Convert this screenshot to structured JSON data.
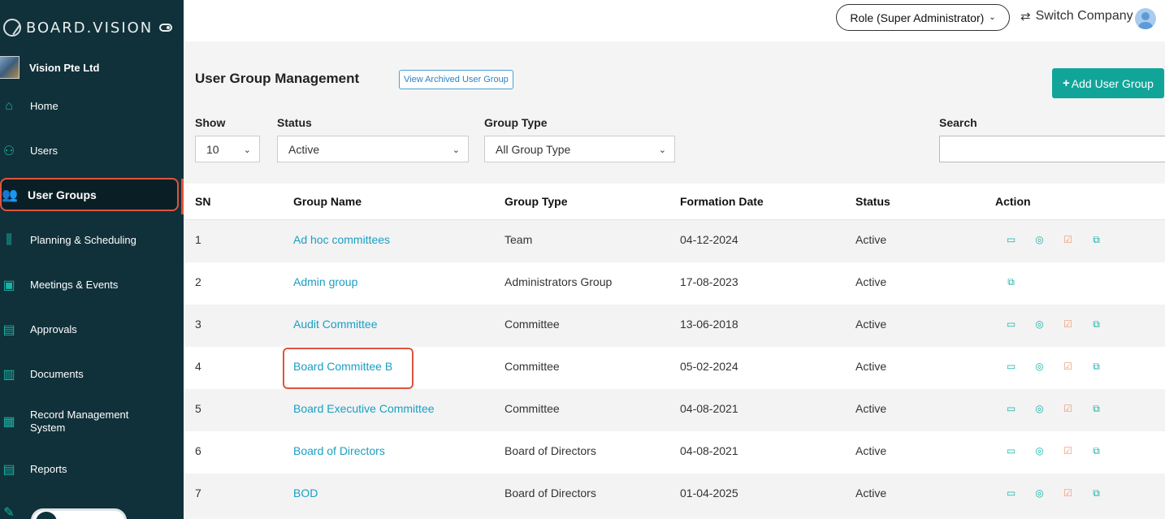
{
  "brand": {
    "name": "BOARD.VISION"
  },
  "company": {
    "name": "Vision Pte Ltd"
  },
  "sidebar": {
    "items": [
      {
        "label": "Home",
        "icon": "home-icon"
      },
      {
        "label": "Users",
        "icon": "user-icon"
      },
      {
        "label": "User Groups",
        "icon": "users-icon",
        "active": true
      },
      {
        "label": "Planning & Scheduling",
        "icon": "bar-chart-icon"
      },
      {
        "label": "Meetings & Events",
        "icon": "calendar-check-icon"
      },
      {
        "label": "Approvals",
        "icon": "document-icon"
      },
      {
        "label": "Documents",
        "icon": "documents-icon"
      },
      {
        "label": "Record Management System",
        "icon": "record-icon"
      },
      {
        "label": "Reports",
        "icon": "report-icon"
      }
    ]
  },
  "topbar": {
    "role": "Role (Super Administrator)",
    "switch_company": "Switch Company"
  },
  "page": {
    "title": "User Group Management",
    "archived_link": "View Archived User Group",
    "add_button": "Add User Group"
  },
  "filters": {
    "show_label": "Show",
    "show_value": "10",
    "status_label": "Status",
    "status_value": "Active",
    "group_type_label": "Group Type",
    "group_type_value": "All Group Type",
    "search_label": "Search",
    "search_value": ""
  },
  "table": {
    "headers": [
      "SN",
      "Group Name",
      "Group Type",
      "Formation Date",
      "Status",
      "Action"
    ],
    "rows": [
      {
        "sn": "1",
        "name": "Ad hoc committees",
        "type": "Team",
        "date": "04-12-2024",
        "status": "Active",
        "actions": [
          "calendar-icon",
          "location-icon",
          "edit-icon",
          "copy-icon"
        ]
      },
      {
        "sn": "2",
        "name": "Admin group",
        "type": "Administrators Group",
        "date": "17-08-2023",
        "status": "Active",
        "actions": [
          "copy-icon"
        ]
      },
      {
        "sn": "3",
        "name": "Audit Committee",
        "type": "Committee",
        "date": "13-06-2018",
        "status": "Active",
        "actions": [
          "calendar-icon",
          "location-icon",
          "edit-icon",
          "copy-icon"
        ]
      },
      {
        "sn": "4",
        "name": "Board Committee B",
        "type": "Committee",
        "date": "05-02-2024",
        "status": "Active",
        "actions": [
          "calendar-icon",
          "location-icon",
          "edit-icon",
          "copy-icon"
        ]
      },
      {
        "sn": "5",
        "name": "Board Executive Committee",
        "type": "Committee",
        "date": "04-08-2021",
        "status": "Active",
        "actions": [
          "calendar-icon",
          "location-icon",
          "edit-icon",
          "copy-icon"
        ]
      },
      {
        "sn": "6",
        "name": "Board of Directors",
        "type": "Board of Directors",
        "date": "04-08-2021",
        "status": "Active",
        "actions": [
          "calendar-icon",
          "location-icon",
          "edit-icon",
          "copy-icon"
        ]
      },
      {
        "sn": "7",
        "name": "BOD",
        "type": "Board of Directors",
        "date": "01-04-2025",
        "status": "Active",
        "actions": [
          "calendar-icon",
          "location-icon",
          "edit-icon",
          "copy-icon"
        ]
      }
    ]
  },
  "colors": {
    "sidebar_bg": "#10313a",
    "accent": "#11a59a",
    "link": "#1a9fc1",
    "highlight": "#e0533d"
  }
}
